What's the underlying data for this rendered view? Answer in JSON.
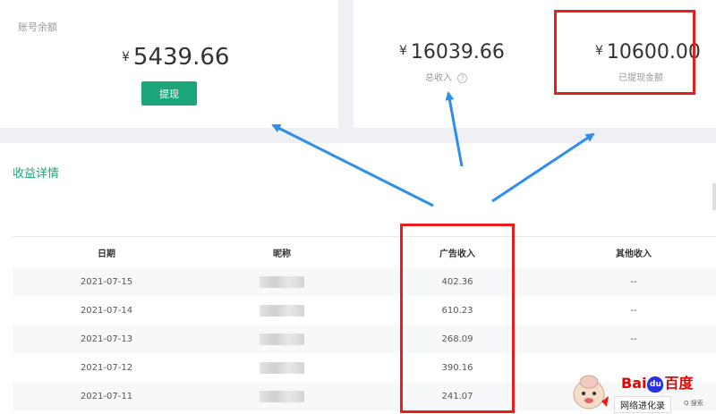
{
  "balance_card": {
    "label": "账号余额",
    "currency": "¥",
    "amount": "5439.66",
    "withdraw_button": "提现"
  },
  "income_card": {
    "total": {
      "currency": "¥",
      "amount": "16039.66",
      "label": "总收入",
      "help_icon": "?"
    },
    "withdrawn": {
      "currency": "¥",
      "amount": "10600.00",
      "label": "已提现金额"
    }
  },
  "earnings": {
    "title": "收益详情",
    "columns": [
      "日期",
      "昵称",
      "广告收入",
      "其他收入"
    ],
    "rows": [
      {
        "date": "2021-07-15",
        "ad_income": "402.36",
        "other": "--"
      },
      {
        "date": "2021-07-14",
        "ad_income": "610.23",
        "other": "--"
      },
      {
        "date": "2021-07-13",
        "ad_income": "268.09",
        "other": "--"
      },
      {
        "date": "2021-07-12",
        "ad_income": "390.16",
        "other": ""
      },
      {
        "date": "2021-07-11",
        "ad_income": "241.07",
        "other": ""
      }
    ]
  },
  "annotations": {
    "box_color": "#e81e1e",
    "arrow_color": "#2e8fe8"
  },
  "watermark": {
    "logo_bai": "Bai",
    "logo_paw": "du",
    "logo_du": "百度",
    "name": "网络进化录",
    "search": "Q 搜索"
  },
  "colors": {
    "accent": "#1aa67a",
    "background": "#eef0f3"
  }
}
